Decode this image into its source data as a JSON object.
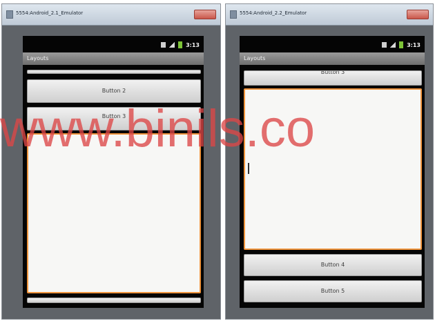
{
  "windows": [
    {
      "title": "5554:Android_2.1_Emulator",
      "status_time": "3:13",
      "app_title": "Layouts",
      "buttons": {
        "b2": "Button 2",
        "b3": "Button 3"
      }
    },
    {
      "title": "5554:Android_2.2_Emulator",
      "status_time": "3:13",
      "app_title": "Layouts",
      "buttons": {
        "b3": "Button 3",
        "b4": "Button 4",
        "b5": "Button 5"
      }
    }
  ],
  "watermark": {
    "text": "www.binils.co"
  },
  "colors": {
    "watermark": "#dc4646",
    "focus_border": "#f0943c",
    "emulator_frame": "#5f6368"
  },
  "icons": [
    "usb-icon",
    "signal-icon",
    "battery-icon",
    "window-icon",
    "close-icon"
  ]
}
